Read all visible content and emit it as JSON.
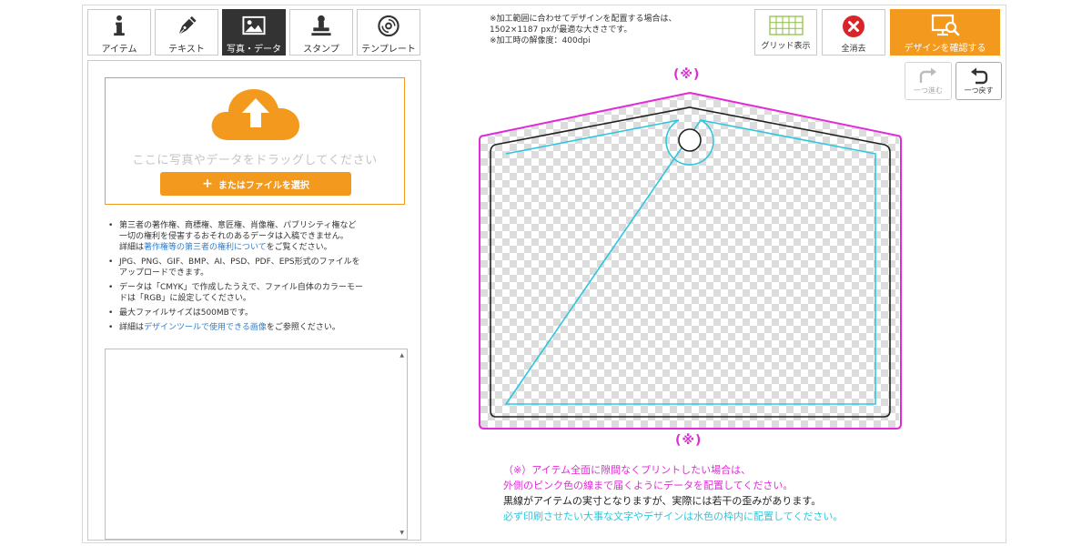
{
  "tabs": [
    {
      "label": "アイテム",
      "icon": "info-icon",
      "active": false
    },
    {
      "label": "テキスト",
      "icon": "pen-icon",
      "active": false
    },
    {
      "label": "写真・データ",
      "icon": "image-icon",
      "active": true
    },
    {
      "label": "スタンプ",
      "icon": "stamp-icon",
      "active": false
    },
    {
      "label": "テンプレート",
      "icon": "disc-icon",
      "active": false
    }
  ],
  "upload": {
    "drop_text": "ここに写真やデータをドラッグしてください",
    "file_button": "またはファイルを選択"
  },
  "notes": {
    "n1_line1": "第三者の著作権、商標権、意匠権、肖像権、パブリシティ権など",
    "n1_line2": "一切の権利を侵害するおそれのあるデータは入稿できません。",
    "n1_line3_pre": "詳細は",
    "n1_link": "著作権等の第三者の権利について",
    "n1_line3_post": "をご覧ください。",
    "n2_line1": "JPG、PNG、GIF、BMP、AI、PSD、PDF、EPS形式のファイルを",
    "n2_line2": "アップロードできます。",
    "n3_line1": "データは「CMYK」で作成したうえで、ファイル自体のカラーモー",
    "n3_line2": "ドは「RGB」に設定してください。",
    "n4": "最大ファイルサイズは500MBです。",
    "n5_pre": "詳細は",
    "n5_link": "デザインツールで使用できる画像",
    "n5_post": "をご参照ください。"
  },
  "info": {
    "line1": "※加工範囲に合わせてデザインを配置する場合は、",
    "line2": "1502×1187 pxが最適な大きさです。",
    "line3": "※加工時の解像度：400dpi"
  },
  "toolbar": {
    "grid_label": "グリッド表示",
    "clear_label": "全消去",
    "confirm_label": "デザインを確認する",
    "redo_label": "一つ進む",
    "undo_label": "一つ戻す"
  },
  "canvas": {
    "mark_top": "(※)",
    "mark_bottom": "(※)"
  },
  "caption": {
    "line1": "（※）アイテム全面に隙間なくプリントしたい場合は、",
    "line2": "外側のピンク色の線まで届くようにデータを配置してください。",
    "line3": "黒線がアイテムの実寸となりますが、実際には若干の歪みがあります。",
    "line4": "必ず印刷させたい大事な文字やデザインは水色の枠内に配置してください。"
  },
  "colors": {
    "accent": "#f39a1e",
    "bleed_line": "#e02bd8",
    "safe_line": "#2ec7de",
    "trim_line": "#222222",
    "link": "#2e7fd0",
    "clear_red": "#d9252a",
    "grid_green": "#8bbf3a"
  }
}
